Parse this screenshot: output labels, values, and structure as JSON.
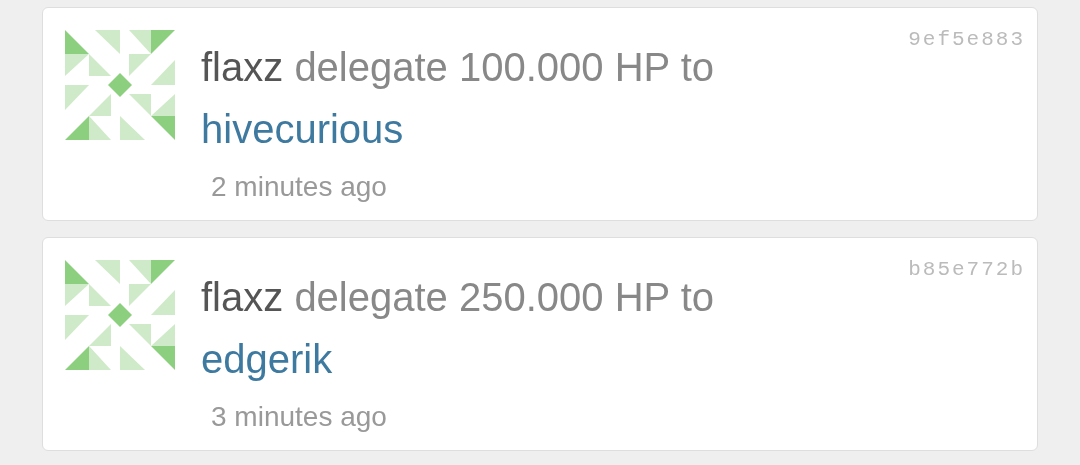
{
  "activities": [
    {
      "actor": "flaxz",
      "action": "delegate 100.000 HP to",
      "target": "hivecurious",
      "time": "2 minutes ago",
      "hash": "9ef5e883"
    },
    {
      "actor": "flaxz",
      "action": "delegate 250.000 HP to",
      "target": "edgerik",
      "time": "3 minutes ago",
      "hash": "b85e772b"
    }
  ]
}
